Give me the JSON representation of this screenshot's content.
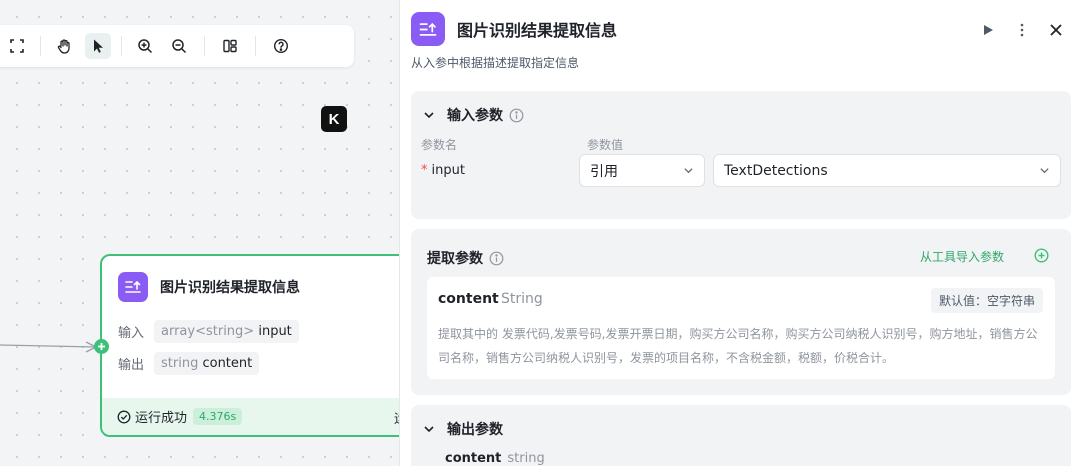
{
  "toolbar": {
    "icons": [
      "fullscreen-icon",
      "hand-icon",
      "pointer-icon",
      "zoom-in-icon",
      "zoom-out-icon",
      "layout-icon",
      "help-icon"
    ],
    "active": "pointer-icon"
  },
  "canvas_badge": "K",
  "node": {
    "title": "图片识别结果提取信息",
    "input_label": "输入",
    "input_type": "array<string>",
    "input_name": "input",
    "output_label": "输出",
    "output_type": "string",
    "output_name": "content",
    "status": "运行成功",
    "duration": "4.376s",
    "footer_extra": "运"
  },
  "panel": {
    "title": "图片识别结果提取信息",
    "description": "从入参中根据描述提取指定信息",
    "input_section": {
      "title": "输入参数",
      "col_name": "参数名",
      "col_value": "参数值",
      "param_name": "input",
      "ref_type": "引用",
      "ref_value": "TextDetections"
    },
    "extract_section": {
      "title": "提取参数",
      "import_label": "从工具导入参数",
      "field_name": "content",
      "field_type": "String",
      "default_label": "默认值：空字符串",
      "field_desc": "提取其中的 发票代码,发票号码,发票开票日期，购买方公司名称，购买方公司纳税人识别号，购方地址，销售方公司名称，销售方公司纳税人识别号，发票的项目名称，不含税金额，税额，价税合计。"
    },
    "output_section": {
      "title": "输出参数",
      "field_name": "content",
      "field_type": "string"
    }
  },
  "colors": {
    "accent_green": "#3ec07a",
    "node_icon_purple": "#8a5cf5"
  }
}
